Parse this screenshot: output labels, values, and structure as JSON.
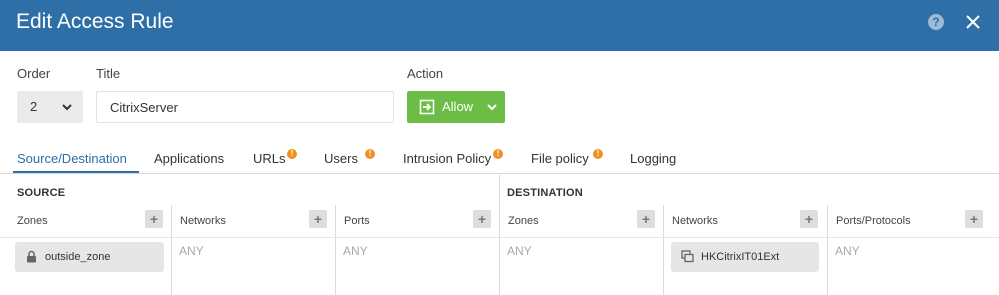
{
  "dialog": {
    "title": "Edit Access Rule"
  },
  "header_icons": {
    "help": "question-circle-icon",
    "close": "close-x-icon"
  },
  "form": {
    "order_label": "Order",
    "order_value": "2",
    "title_label": "Title",
    "title_value": "CitrixServer",
    "action_label": "Action",
    "action_value": "Allow"
  },
  "tabs": [
    {
      "label": "Source/Destination",
      "active": true,
      "warning": false
    },
    {
      "label": "Applications",
      "active": false,
      "warning": false
    },
    {
      "label": "URLs",
      "active": false,
      "warning": true
    },
    {
      "label": "Users",
      "active": false,
      "warning": true
    },
    {
      "label": "Intrusion Policy",
      "active": false,
      "warning": true
    },
    {
      "label": "File policy",
      "active": false,
      "warning": true
    },
    {
      "label": "Logging",
      "active": false,
      "warning": false
    }
  ],
  "warning_badge": "!",
  "add_glyph": "+",
  "source": {
    "heading": "SOURCE",
    "columns": [
      {
        "label": "Zones",
        "value": "outside_zone",
        "is_chip": true,
        "chip_icon": "lock-icon"
      },
      {
        "label": "Networks",
        "value": "ANY",
        "is_chip": false
      },
      {
        "label": "Ports",
        "value": "ANY",
        "is_chip": false
      }
    ]
  },
  "destination": {
    "heading": "DESTINATION",
    "columns": [
      {
        "label": "Zones",
        "value": "ANY",
        "is_chip": false
      },
      {
        "label": "Networks",
        "value": "HKCitrixIT01Ext",
        "is_chip": true,
        "chip_icon": "network-object-icon"
      },
      {
        "label": "Ports/Protocols",
        "value": "ANY",
        "is_chip": false
      }
    ]
  },
  "colors": {
    "header_bg": "#2d6fa6",
    "allow_green": "#6cbd45",
    "warning_orange": "#f0901e",
    "active_tab": "#2d6fa6"
  }
}
